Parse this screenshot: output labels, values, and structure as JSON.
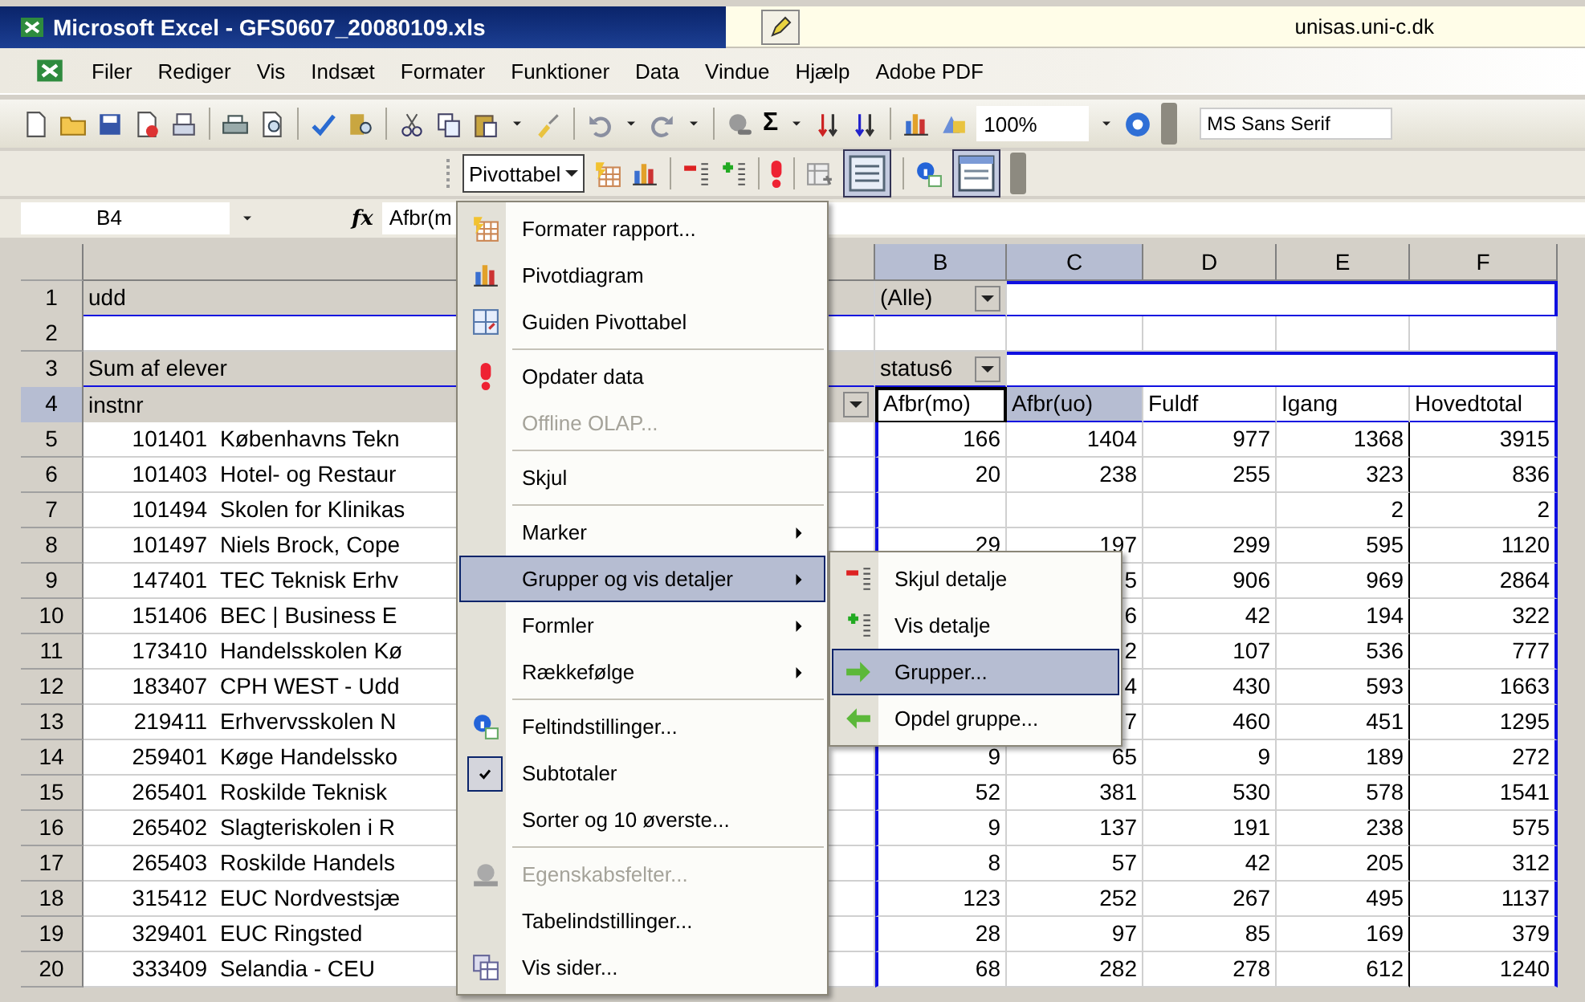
{
  "window": {
    "title": "Microsoft Excel - GFS0607_20080109.xls",
    "host": "unisas.uni-c.dk"
  },
  "menu_bar": [
    "Filer",
    "Rediger",
    "Vis",
    "Indsæt",
    "Formater",
    "Funktioner",
    "Data",
    "Vindue",
    "Hjælp",
    "Adobe PDF"
  ],
  "standard_toolbar": {
    "autosum": "Σ",
    "zoom": "100%",
    "font": "MS Sans Serif"
  },
  "pivot_toolbar": {
    "button": "Pivottabel"
  },
  "formula_bar": {
    "name_box": "B4",
    "function_symbol": "fx",
    "formula": "Afbr(m"
  },
  "sheet": {
    "columns": [
      {
        "label": "B",
        "selected": true
      },
      {
        "label": "C",
        "selected": true
      },
      {
        "label": "D",
        "selected": false
      },
      {
        "label": "E",
        "selected": false
      },
      {
        "label": "F",
        "selected": false
      }
    ],
    "rows": [
      {
        "number": "1",
        "selected": false,
        "kind": "page_field",
        "label": "udd",
        "value": "(Alle)"
      },
      {
        "number": "2",
        "selected": false,
        "kind": "blank"
      },
      {
        "number": "3",
        "selected": false,
        "kind": "data_field",
        "label": "Sum af elever",
        "value": "status6"
      },
      {
        "number": "4",
        "selected": true,
        "kind": "header",
        "label": "instnr",
        "headers": [
          {
            "text": "Afbr(mo)",
            "selected": false
          },
          {
            "text": "Afbr(uo)",
            "selected": true
          },
          {
            "text": "Fuldf",
            "selected": false
          },
          {
            "text": "Igang",
            "selected": false
          },
          {
            "text": "Hovedtotal",
            "selected": false
          }
        ]
      },
      {
        "number": "5",
        "selected": false,
        "kind": "data",
        "code": "101401",
        "name": "Københavns Tekn",
        "values": [
          {
            "text": "166"
          },
          {
            "text": "1404"
          },
          {
            "text": "977"
          },
          {
            "text": "1368"
          },
          {
            "text": "3915"
          }
        ]
      },
      {
        "number": "6",
        "selected": false,
        "kind": "data",
        "code": "101403",
        "name": "Hotel- og Restaur",
        "values": [
          {
            "text": "20"
          },
          {
            "text": "238"
          },
          {
            "text": "255"
          },
          {
            "text": "323"
          },
          {
            "text": "836"
          }
        ]
      },
      {
        "number": "7",
        "selected": false,
        "kind": "data",
        "code": "101494",
        "name": "Skolen for Klinikas",
        "values": [
          {
            "text": "2"
          },
          {
            "text": "2"
          }
        ]
      },
      {
        "number": "8",
        "selected": false,
        "kind": "data",
        "code": "101497",
        "name": "Niels Brock, Cope",
        "values": [
          {
            "text": "29"
          },
          {
            "text": "197"
          },
          {
            "text": "299"
          },
          {
            "text": "595"
          },
          {
            "text": "1120"
          }
        ]
      },
      {
        "number": "9",
        "selected": false,
        "kind": "data",
        "code": "147401",
        "name": "TEC Teknisk Erhv",
        "values": [
          {
            "text": "5"
          },
          {
            "text": "906"
          },
          {
            "text": "969"
          },
          {
            "text": "2864"
          }
        ]
      },
      {
        "number": "10",
        "selected": false,
        "kind": "data",
        "code": "151406",
        "name": "BEC | Business E",
        "values": [
          {
            "text": "6"
          },
          {
            "text": "42"
          },
          {
            "text": "194"
          },
          {
            "text": "322"
          }
        ]
      },
      {
        "number": "11",
        "selected": false,
        "kind": "data",
        "code": "173410",
        "name": "Handelsskolen Kø",
        "values": [
          {
            "text": "2"
          },
          {
            "text": "107"
          },
          {
            "text": "536"
          },
          {
            "text": "777"
          }
        ]
      },
      {
        "number": "12",
        "selected": false,
        "kind": "data",
        "code": "183407",
        "name": "CPH WEST - Udd",
        "values": [
          {
            "text": "4"
          },
          {
            "text": "430"
          },
          {
            "text": "593"
          },
          {
            "text": "1663"
          }
        ]
      },
      {
        "number": "13",
        "selected": false,
        "kind": "data",
        "code": "219411",
        "name": "Erhvervsskolen N",
        "values": [
          {
            "text": "7"
          },
          {
            "text": "460"
          },
          {
            "text": "451"
          },
          {
            "text": "1295"
          }
        ]
      },
      {
        "number": "14",
        "selected": false,
        "kind": "data",
        "code": "259401",
        "name": "Køge Handelssko",
        "values": [
          {
            "text": "9"
          },
          {
            "text": "65"
          },
          {
            "text": "9"
          },
          {
            "text": "189"
          },
          {
            "text": "272"
          }
        ]
      },
      {
        "number": "15",
        "selected": false,
        "kind": "data",
        "code": "265401",
        "name": "Roskilde Teknisk",
        "values": [
          {
            "text": "52"
          },
          {
            "text": "381"
          },
          {
            "text": "530"
          },
          {
            "text": "578"
          },
          {
            "text": "1541"
          }
        ]
      },
      {
        "number": "16",
        "selected": false,
        "kind": "data",
        "code": "265402",
        "name": "Slagteriskolen i R",
        "values": [
          {
            "text": "9"
          },
          {
            "text": "137"
          },
          {
            "text": "191"
          },
          {
            "text": "238"
          },
          {
            "text": "575"
          }
        ]
      },
      {
        "number": "17",
        "selected": false,
        "kind": "data",
        "code": "265403",
        "name": "Roskilde Handels",
        "values": [
          {
            "text": "8"
          },
          {
            "text": "57"
          },
          {
            "text": "42"
          },
          {
            "text": "205"
          },
          {
            "text": "312"
          }
        ]
      },
      {
        "number": "18",
        "selected": false,
        "kind": "data",
        "code": "315412",
        "name": "EUC Nordvestsjæ",
        "values": [
          {
            "text": "123"
          },
          {
            "text": "252"
          },
          {
            "text": "267"
          },
          {
            "text": "495"
          },
          {
            "text": "1137"
          }
        ]
      },
      {
        "number": "19",
        "selected": false,
        "kind": "data",
        "code": "329401",
        "name": "EUC Ringsted",
        "values": [
          {
            "text": "28"
          },
          {
            "text": "97"
          },
          {
            "text": "85"
          },
          {
            "text": "169"
          },
          {
            "text": "379"
          }
        ]
      },
      {
        "number": "20",
        "selected": false,
        "kind": "data",
        "code": "333409",
        "name": "Selandia - CEU",
        "values": [
          {
            "text": "68"
          },
          {
            "text": "282"
          },
          {
            "text": "278"
          },
          {
            "text": "612"
          },
          {
            "text": "1240"
          }
        ]
      }
    ]
  },
  "context_menu": {
    "items": [
      {
        "kind": "item",
        "label": "Formater rapport...",
        "disabled": false,
        "checked": false,
        "submenu": false,
        "selected": false
      },
      {
        "kind": "item",
        "label": "Pivotdiagram",
        "disabled": false,
        "checked": false,
        "submenu": false,
        "selected": false
      },
      {
        "kind": "item",
        "label": "Guiden Pivottabel",
        "disabled": false,
        "checked": false,
        "submenu": false,
        "selected": false
      },
      {
        "kind": "separator"
      },
      {
        "kind": "item",
        "label": "Opdater data",
        "disabled": false,
        "checked": false,
        "submenu": false,
        "selected": false
      },
      {
        "kind": "item",
        "label": "Offline OLAP...",
        "disabled": true,
        "checked": false,
        "submenu": false,
        "selected": false
      },
      {
        "kind": "separator"
      },
      {
        "kind": "item",
        "label": "Skjul",
        "disabled": false,
        "checked": false,
        "submenu": false,
        "selected": false
      },
      {
        "kind": "separator"
      },
      {
        "kind": "item",
        "label": "Marker",
        "disabled": false,
        "checked": false,
        "submenu": true,
        "selected": false
      },
      {
        "kind": "item",
        "label": "Grupper og vis detaljer",
        "disabled": false,
        "checked": false,
        "submenu": true,
        "selected": true
      },
      {
        "kind": "item",
        "label": "Formler",
        "disabled": false,
        "checked": false,
        "submenu": true,
        "selected": false
      },
      {
        "kind": "item",
        "label": "Rækkefølge",
        "disabled": false,
        "checked": false,
        "submenu": true,
        "selected": false
      },
      {
        "kind": "separator"
      },
      {
        "kind": "item",
        "label": "Feltindstillinger...",
        "disabled": false,
        "checked": false,
        "submenu": false,
        "selected": false
      },
      {
        "kind": "item",
        "label": "Subtotaler",
        "disabled": false,
        "checked": true,
        "submenu": false,
        "selected": false
      },
      {
        "kind": "item",
        "label": "Sorter og 10 øverste...",
        "disabled": false,
        "checked": false,
        "submenu": false,
        "selected": false
      },
      {
        "kind": "separator"
      },
      {
        "kind": "item",
        "label": "Egenskabsfelter...",
        "disabled": true,
        "checked": false,
        "submenu": false,
        "selected": false
      },
      {
        "kind": "item",
        "label": "Tabelindstillinger...",
        "disabled": false,
        "checked": false,
        "submenu": false,
        "selected": false
      },
      {
        "kind": "item",
        "label": "Vis sider...",
        "disabled": false,
        "checked": false,
        "submenu": false,
        "selected": false
      }
    ]
  },
  "submenu": {
    "items": [
      {
        "label": "Skjul detalje",
        "selected": false
      },
      {
        "label": "Vis detalje",
        "selected": false
      },
      {
        "label": "Grupper...",
        "selected": true
      },
      {
        "label": "Opdel gruppe...",
        "selected": false
      }
    ]
  }
}
